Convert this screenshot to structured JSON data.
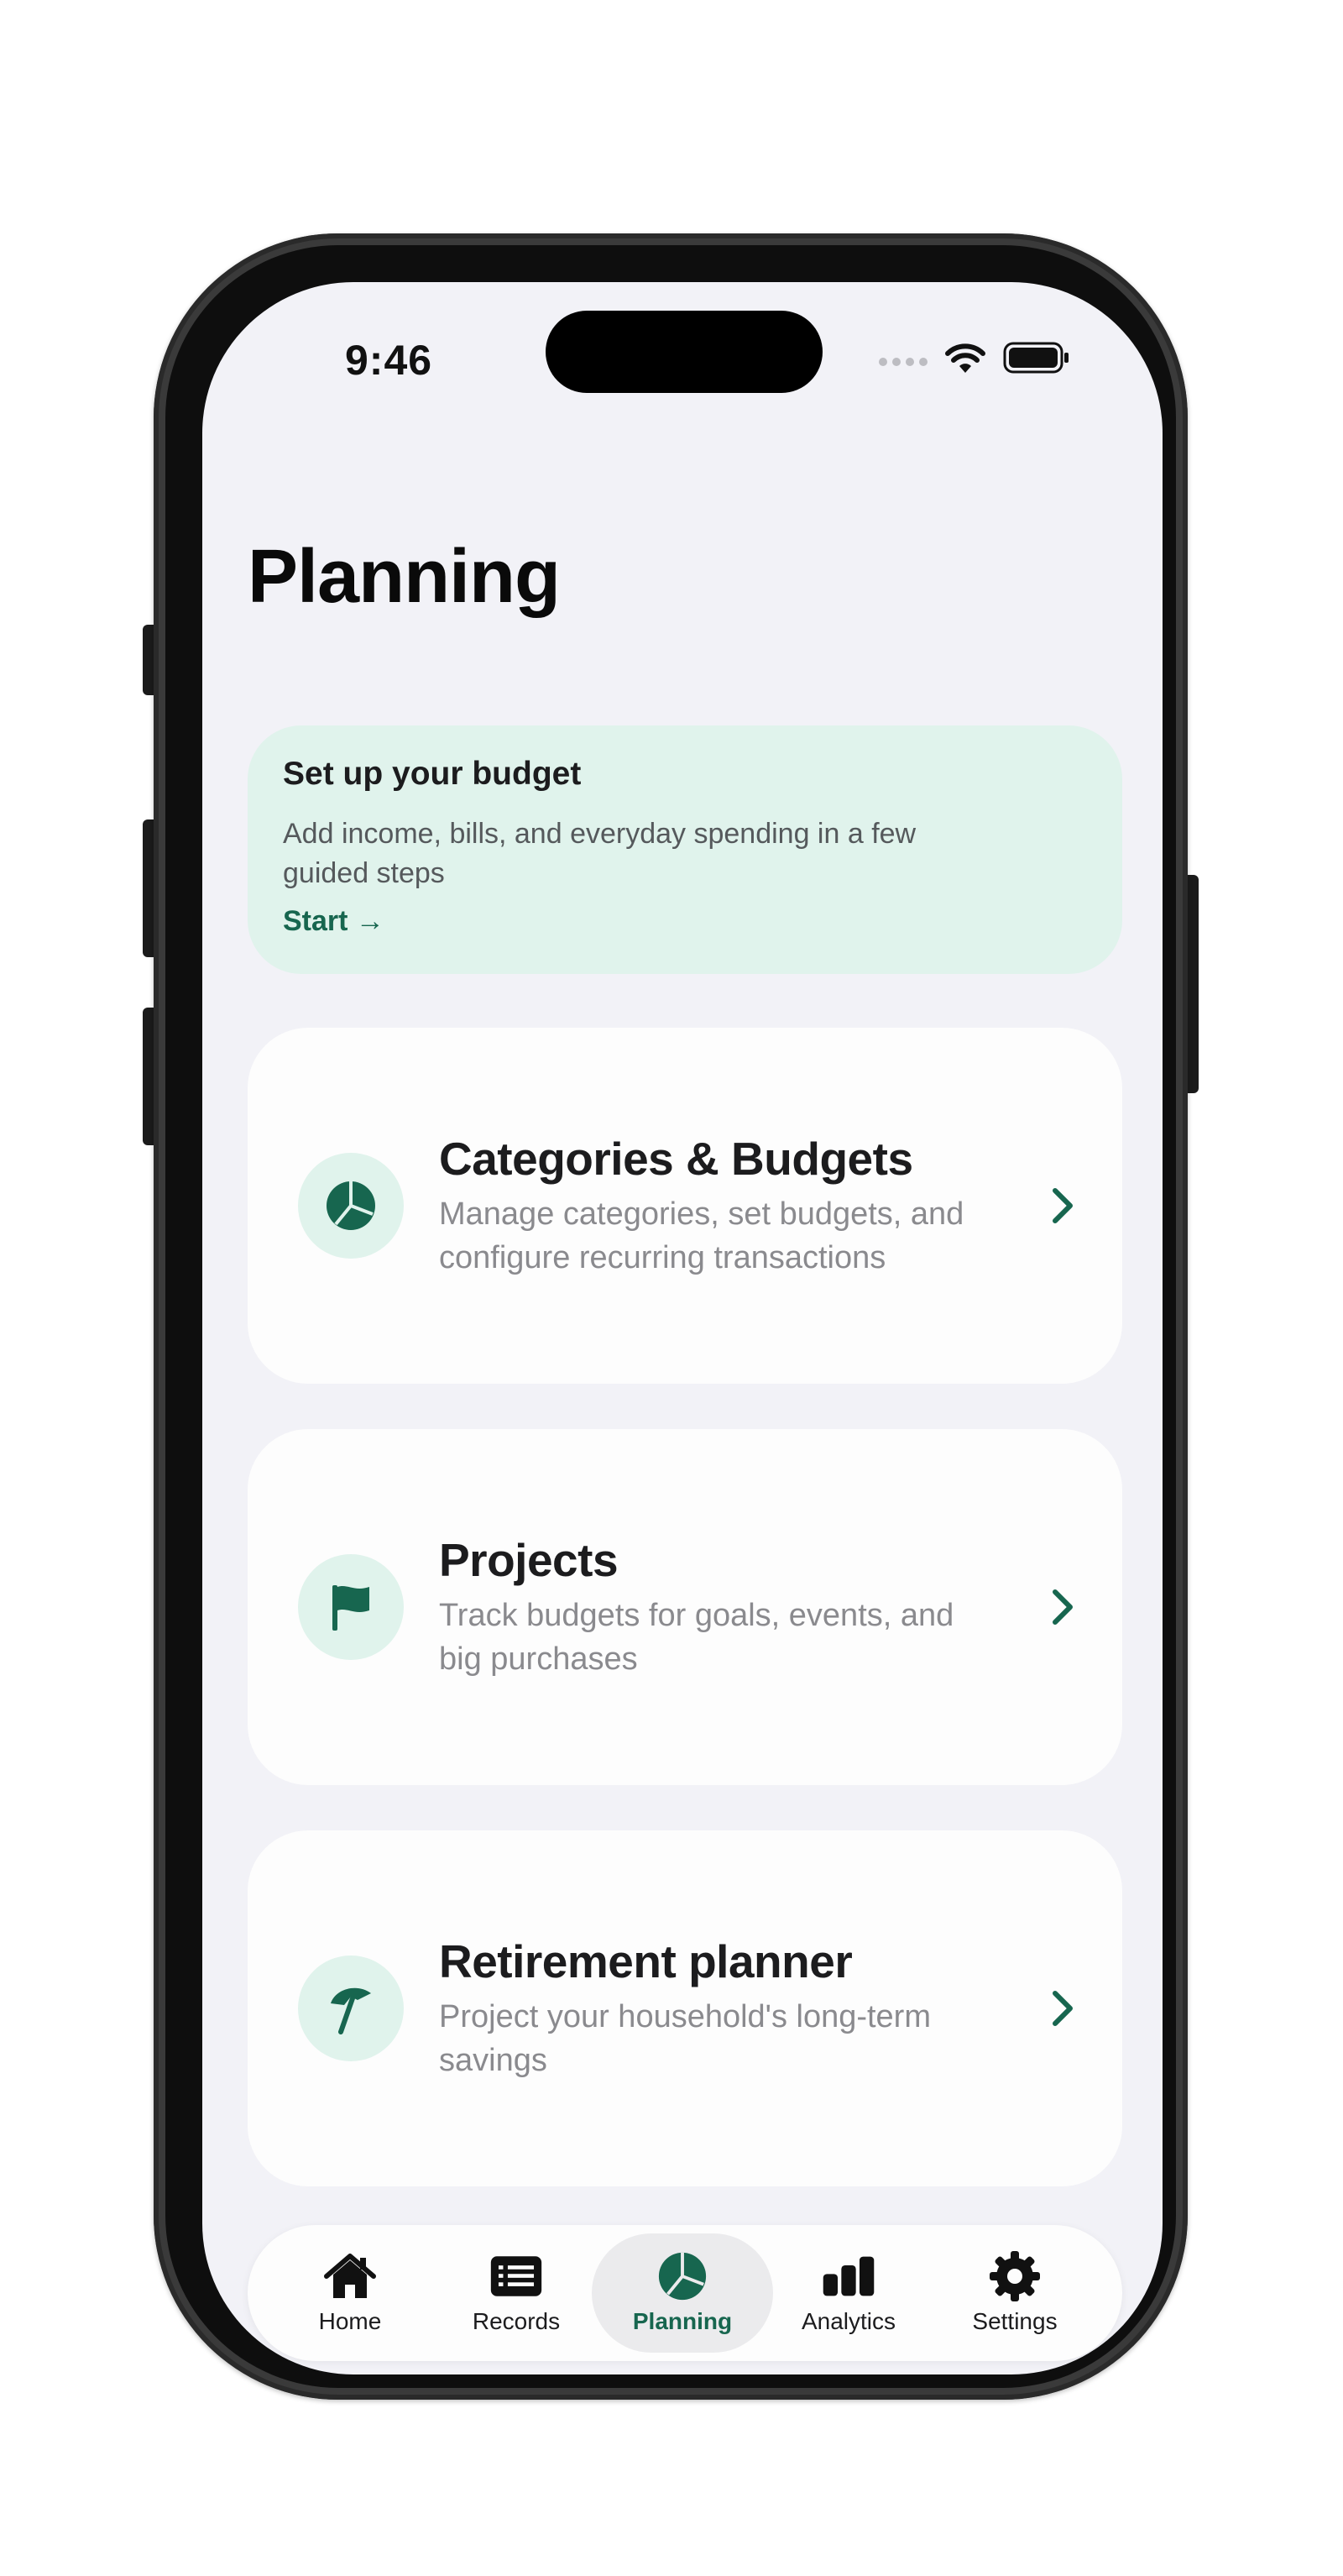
{
  "status_bar": {
    "time": "9:46"
  },
  "page": {
    "title": "Planning"
  },
  "setup_banner": {
    "title": "Set up your budget",
    "description": "Add income, bills, and everyday spending in a few guided steps",
    "action_label": "Start →"
  },
  "feature_cards": [
    {
      "title": "Categories & Budgets",
      "description": "Manage categories, set budgets, and configure recurring transactions",
      "icon": "pie-chart-icon"
    },
    {
      "title": "Projects",
      "description": "Track budgets for goals, events, and big purchases",
      "icon": "flag-icon"
    },
    {
      "title": "Retirement planner",
      "description": "Project your household's long-term savings",
      "icon": "beach-umbrella-icon"
    }
  ],
  "tab_bar": {
    "selected": "Planning",
    "tabs": [
      {
        "label": "Home",
        "icon": "house-icon"
      },
      {
        "label": "Records",
        "icon": "list-icon"
      },
      {
        "label": "Planning",
        "icon": "pie-chart-icon"
      },
      {
        "label": "Analytics",
        "icon": "bar-chart-icon"
      },
      {
        "label": "Settings",
        "icon": "gear-icon"
      }
    ]
  },
  "colors": {
    "accent": "#17664f",
    "accent_soft": "#e0f3ec",
    "background": "#f2f2f7",
    "card": "#fdfdfd"
  }
}
